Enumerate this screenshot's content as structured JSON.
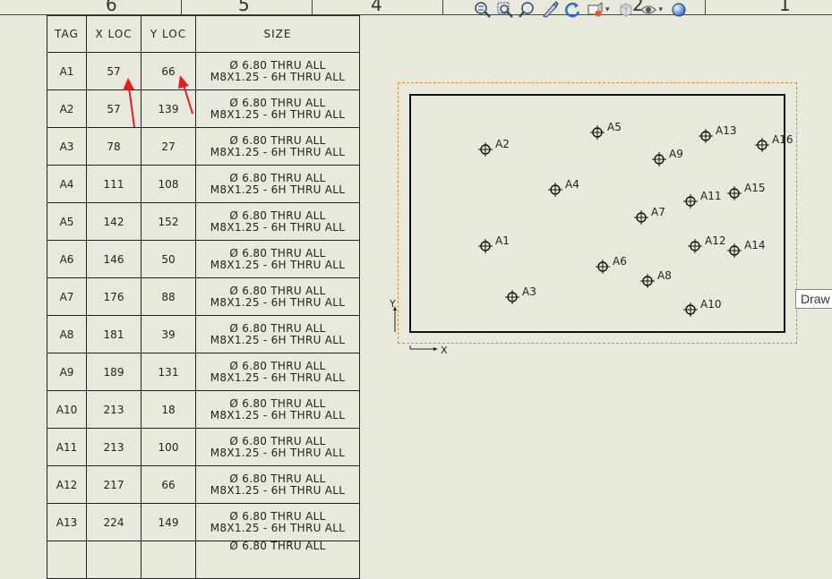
{
  "zone_ruler": [
    "6",
    "5",
    "4",
    "2",
    "1"
  ],
  "hole_table": {
    "headers": {
      "tag": "TAG",
      "x": "X LOC",
      "y": "Y LOC",
      "size": "SIZE"
    },
    "rows": [
      {
        "tag": "A1",
        "x": "57",
        "y": "66",
        "size1": "Ø 6.80 THRU ALL",
        "size2": "M8X1.25 - 6H THRU ALL"
      },
      {
        "tag": "A2",
        "x": "57",
        "y": "139",
        "size1": "Ø 6.80 THRU ALL",
        "size2": "M8X1.25 - 6H THRU ALL"
      },
      {
        "tag": "A3",
        "x": "78",
        "y": "27",
        "size1": "Ø 6.80 THRU ALL",
        "size2": "M8X1.25 - 6H THRU ALL"
      },
      {
        "tag": "A4",
        "x": "111",
        "y": "108",
        "size1": "Ø 6.80 THRU ALL",
        "size2": "M8X1.25 - 6H THRU ALL"
      },
      {
        "tag": "A5",
        "x": "142",
        "y": "152",
        "size1": "Ø 6.80 THRU ALL",
        "size2": "M8X1.25 - 6H THRU ALL"
      },
      {
        "tag": "A6",
        "x": "146",
        "y": "50",
        "size1": "Ø 6.80 THRU ALL",
        "size2": "M8X1.25 - 6H THRU ALL"
      },
      {
        "tag": "A7",
        "x": "176",
        "y": "88",
        "size1": "Ø 6.80 THRU ALL",
        "size2": "M8X1.25 - 6H THRU ALL"
      },
      {
        "tag": "A8",
        "x": "181",
        "y": "39",
        "size1": "Ø 6.80 THRU ALL",
        "size2": "M8X1.25 - 6H THRU ALL"
      },
      {
        "tag": "A9",
        "x": "189",
        "y": "131",
        "size1": "Ø 6.80 THRU ALL",
        "size2": "M8X1.25 - 6H THRU ALL"
      },
      {
        "tag": "A10",
        "x": "213",
        "y": "18",
        "size1": "Ø 6.80 THRU ALL",
        "size2": "M8X1.25 - 6H THRU ALL"
      },
      {
        "tag": "A11",
        "x": "213",
        "y": "100",
        "size1": "Ø 6.80 THRU ALL",
        "size2": "M8X1.25 - 6H THRU ALL"
      },
      {
        "tag": "A12",
        "x": "217",
        "y": "66",
        "size1": "Ø 6.80 THRU ALL",
        "size2": "M8X1.25 - 6H THRU ALL"
      },
      {
        "tag": "A13",
        "x": "224",
        "y": "149",
        "size1": "Ø 6.80 THRU ALL",
        "size2": "M8X1.25 - 6H THRU ALL"
      },
      {
        "tag": "",
        "x": "",
        "y": "",
        "size1": "Ø 6.80 THRU ALL",
        "size2": ""
      }
    ]
  },
  "drawing_view": {
    "holes": [
      {
        "tag": "A1"
      },
      {
        "tag": "A2"
      },
      {
        "tag": "A3"
      },
      {
        "tag": "A4"
      },
      {
        "tag": "A5"
      },
      {
        "tag": "A6"
      },
      {
        "tag": "A7"
      },
      {
        "tag": "A8"
      },
      {
        "tag": "A9"
      },
      {
        "tag": "A10"
      },
      {
        "tag": "A11"
      },
      {
        "tag": "A12"
      },
      {
        "tag": "A13"
      },
      {
        "tag": "A14"
      },
      {
        "tag": "A15"
      },
      {
        "tag": "A16"
      }
    ],
    "axis_x_label": "X",
    "axis_y_label": "Y"
  },
  "toolbar": {
    "icons": [
      "zoom-to-fit-icon",
      "zoom-to-area-icon",
      "zoom-in-out-icon",
      "select-icon",
      "rotate-icon",
      "view-orientation-icon",
      "display-style-icon",
      "hide-show-icon",
      "appearance-icon"
    ]
  },
  "tooltip": {
    "text": "Draw"
  },
  "colors": {
    "annotation_arrow": "#e02020",
    "view_boundary": "#e08a2a",
    "sheet_background": "#e9e8dd"
  }
}
